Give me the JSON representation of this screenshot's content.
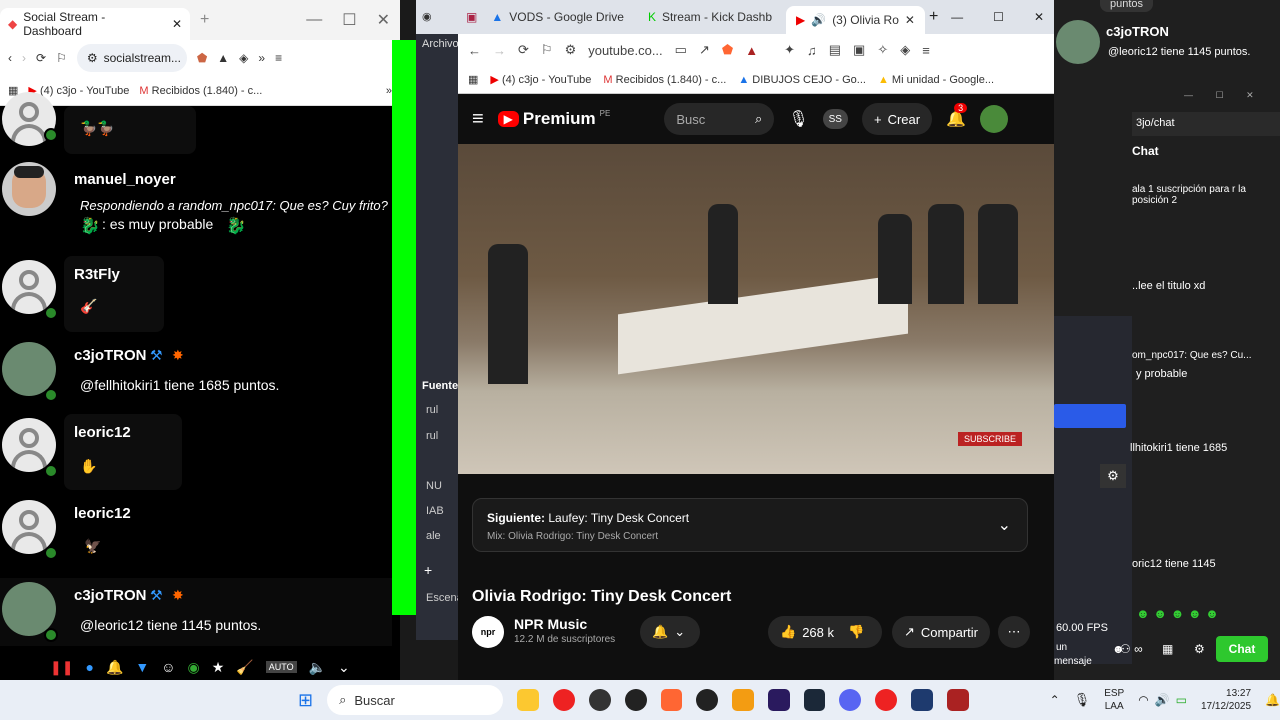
{
  "left_browser": {
    "tab_title": "Social Stream - Dashboard",
    "url": "socialstream...",
    "bookmarks": [
      "(4) c3jo - YouTube",
      "Recibidos (1.840) - c..."
    ],
    "messages": [
      {
        "user": "",
        "text": ""
      },
      {
        "user": "manuel_noyer",
        "reply": "Respondiendo a random_npc017: Que es? Cuy frito?",
        "text": ": es muy probable"
      },
      {
        "user": "R3tFly",
        "text": ""
      },
      {
        "user": "c3joTRON",
        "text": "@fellhitokiri1 tiene 1685 puntos."
      },
      {
        "user": "leoric12",
        "text": ""
      },
      {
        "user": "leoric12",
        "text": ""
      },
      {
        "user": "c3joTRON",
        "text": "@leoric12 tiene 1145 puntos."
      }
    ]
  },
  "obs": {
    "menu": "Archivo",
    "label_fuentes": "Fuente",
    "label_escena": "Escena",
    "items": [
      "rul",
      "rul",
      "NU",
      "IAB",
      "ale"
    ]
  },
  "center_browser": {
    "tabs": [
      "OBS",
      "VODS - Google Drive",
      "Stream - Kick Dashb",
      "(3) Olivia Ro"
    ],
    "url": "youtube.co...",
    "bookmarks": [
      "(4) c3jo - YouTube",
      "Recibidos (1.840) - c...",
      "DIBUJOS CEJO - Go...",
      "Mi unidad - Google..."
    ],
    "yt": {
      "logo": "Premium",
      "region": "PE",
      "search_placeholder": "Busc",
      "ss": "SS",
      "create": "Crear",
      "notif_count": "3",
      "next_label": "Siguiente:",
      "next_title": "Laufey: Tiny Desk Concert",
      "mix": "Mix: Olivia Rodrigo: Tiny Desk Concert",
      "video_title": "Olivia Rodrigo: Tiny Desk Concert",
      "channel": "NPR Music",
      "subs": "12.2 M de suscriptores",
      "likes": "268 k",
      "share": "Compartir",
      "watermark": "SUBSCRIBE"
    }
  },
  "right_overlay": {
    "user": "c3joTRON",
    "text": "@leoric12 tiene 1145 puntos.",
    "top_text": "puntos",
    "url": "3jo/chat",
    "chat_title": "Chat",
    "msgs": [
      "ala 1 suscripción para r la posición 2",
      "..lee el titulo xd",
      "om_npc017: Que es? Cu...",
      "y probable",
      "llhitokiri1 tiene 1685",
      "oric12 tiene 1145"
    ],
    "fps": "60.00 FPS",
    "mensaje": "mensaje",
    "chat_button": "Chat",
    "un": "un"
  },
  "taskbar": {
    "search": "Buscar",
    "lang1": "ESP",
    "lang2": "LAA",
    "time": "13:27",
    "date": "17/12/2025"
  }
}
